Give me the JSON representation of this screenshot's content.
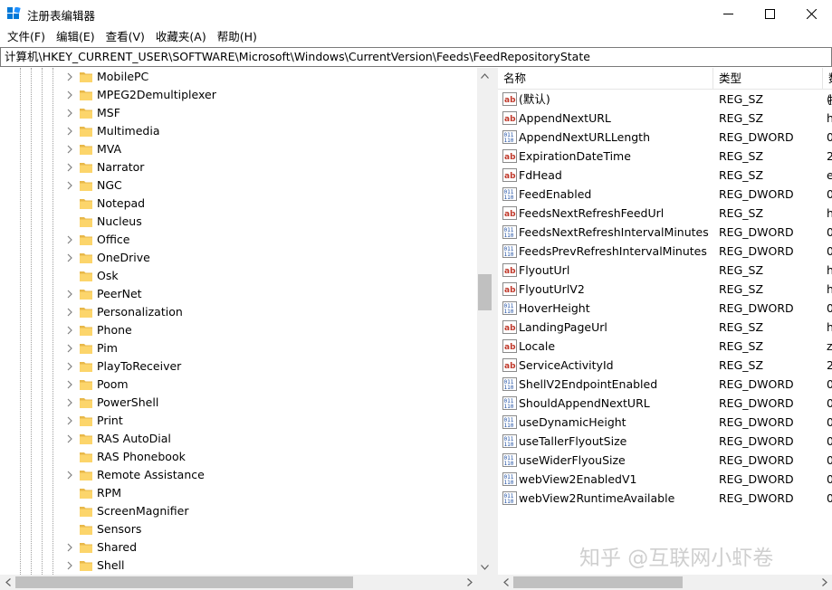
{
  "window": {
    "title": "注册表编辑器",
    "accent": "#0078d7"
  },
  "menu": [
    "文件(F)",
    "编辑(E)",
    "查看(V)",
    "收藏夹(A)",
    "帮助(H)"
  ],
  "address": "计算机\\HKEY_CURRENT_USER\\SOFTWARE\\Microsoft\\Windows\\CurrentVersion\\Feeds\\FeedRepositoryState",
  "tree": [
    {
      "label": "MobilePC",
      "expandable": true
    },
    {
      "label": "MPEG2Demultiplexer",
      "expandable": true
    },
    {
      "label": "MSF",
      "expandable": true
    },
    {
      "label": "Multimedia",
      "expandable": true
    },
    {
      "label": "MVA",
      "expandable": true
    },
    {
      "label": "Narrator",
      "expandable": true
    },
    {
      "label": "NGC",
      "expandable": true
    },
    {
      "label": "Notepad",
      "expandable": false
    },
    {
      "label": "Nucleus",
      "expandable": false
    },
    {
      "label": "Office",
      "expandable": true
    },
    {
      "label": "OneDrive",
      "expandable": true
    },
    {
      "label": "Osk",
      "expandable": false
    },
    {
      "label": "PeerNet",
      "expandable": true
    },
    {
      "label": "Personalization",
      "expandable": true
    },
    {
      "label": "Phone",
      "expandable": true
    },
    {
      "label": "Pim",
      "expandable": true
    },
    {
      "label": "PlayToReceiver",
      "expandable": true
    },
    {
      "label": "Poom",
      "expandable": true
    },
    {
      "label": "PowerShell",
      "expandable": true
    },
    {
      "label": "Print",
      "expandable": true
    },
    {
      "label": "RAS AutoDial",
      "expandable": true
    },
    {
      "label": "RAS Phonebook",
      "expandable": false
    },
    {
      "label": "Remote Assistance",
      "expandable": true
    },
    {
      "label": "RPM",
      "expandable": false
    },
    {
      "label": "ScreenMagnifier",
      "expandable": false
    },
    {
      "label": "Sensors",
      "expandable": false
    },
    {
      "label": "Shared",
      "expandable": true
    },
    {
      "label": "Shell",
      "expandable": true
    }
  ],
  "list": {
    "columns": {
      "name": "名称",
      "type": "类型",
      "data": "数据"
    },
    "rows": [
      {
        "icon": "string",
        "name": "(默认)",
        "type": "REG_SZ",
        "data": "("
      },
      {
        "icon": "string",
        "name": "AppendNextURL",
        "type": "REG_SZ",
        "data": "h"
      },
      {
        "icon": "binary",
        "name": "AppendNextURLLength",
        "type": "REG_DWORD",
        "data": "0"
      },
      {
        "icon": "string",
        "name": "ExpirationDateTime",
        "type": "REG_SZ",
        "data": "2"
      },
      {
        "icon": "string",
        "name": "FdHead",
        "type": "REG_SZ",
        "data": "e"
      },
      {
        "icon": "binary",
        "name": "FeedEnabled",
        "type": "REG_DWORD",
        "data": "0"
      },
      {
        "icon": "string",
        "name": "FeedsNextRefreshFeedUrl",
        "type": "REG_SZ",
        "data": "h"
      },
      {
        "icon": "binary",
        "name": "FeedsNextRefreshIntervalMinutes",
        "type": "REG_DWORD",
        "data": "0"
      },
      {
        "icon": "binary",
        "name": "FeedsPrevRefreshIntervalMinutes",
        "type": "REG_DWORD",
        "data": "0"
      },
      {
        "icon": "string",
        "name": "FlyoutUrl",
        "type": "REG_SZ",
        "data": "h"
      },
      {
        "icon": "string",
        "name": "FlyoutUrlV2",
        "type": "REG_SZ",
        "data": "h"
      },
      {
        "icon": "binary",
        "name": "HoverHeight",
        "type": "REG_DWORD",
        "data": "0"
      },
      {
        "icon": "string",
        "name": "LandingPageUrl",
        "type": "REG_SZ",
        "data": "h"
      },
      {
        "icon": "string",
        "name": "Locale",
        "type": "REG_SZ",
        "data": "z"
      },
      {
        "icon": "string",
        "name": "ServiceActivityId",
        "type": "REG_SZ",
        "data": "2"
      },
      {
        "icon": "binary",
        "name": "ShellV2EndpointEnabled",
        "type": "REG_DWORD",
        "data": "0"
      },
      {
        "icon": "binary",
        "name": "ShouldAppendNextURL",
        "type": "REG_DWORD",
        "data": "0"
      },
      {
        "icon": "binary",
        "name": "useDynamicHeight",
        "type": "REG_DWORD",
        "data": "0"
      },
      {
        "icon": "binary",
        "name": "useTallerFlyoutSize",
        "type": "REG_DWORD",
        "data": "0"
      },
      {
        "icon": "binary",
        "name": "useWiderFlyouSize",
        "type": "REG_DWORD",
        "data": "0"
      },
      {
        "icon": "binary",
        "name": "webView2EnabledV1",
        "type": "REG_DWORD",
        "data": "0"
      },
      {
        "icon": "binary",
        "name": "webView2RuntimeAvailable",
        "type": "REG_DWORD",
        "data": "0"
      }
    ]
  },
  "watermark": "知乎 @互联网小虾卷"
}
